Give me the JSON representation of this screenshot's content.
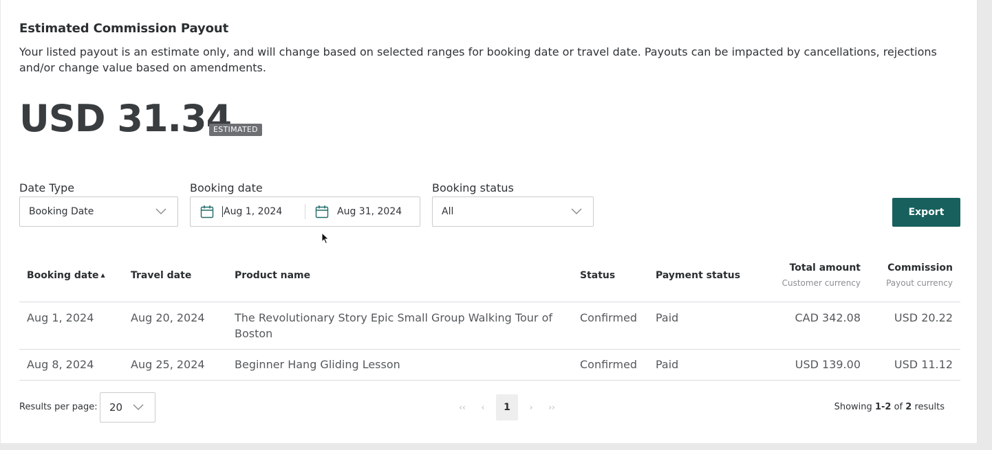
{
  "header": {
    "title": "Estimated Commission Payout",
    "description": "Your listed payout is an estimate only, and will change based on selected ranges for booking date or travel date. Payouts can be impacted by cancellations, rejections and/or change value based on amendments.",
    "amount": "USD 31.34",
    "badge": "ESTIMATED"
  },
  "filters": {
    "date_type_label": "Date Type",
    "date_type_value": "Booking Date",
    "booking_date_label": "Booking date",
    "start_date": "Aug 1, 2024",
    "end_date": "Aug 31, 2024",
    "status_label": "Booking status",
    "status_value": "All",
    "export_label": "Export"
  },
  "table": {
    "columns": {
      "booking_date": "Booking date",
      "travel_date": "Travel date",
      "product_name": "Product name",
      "status": "Status",
      "payment_status": "Payment status",
      "total_amount": "Total amount",
      "total_amount_sub": "Customer currency",
      "commission": "Commission",
      "commission_sub": "Payout currency"
    },
    "rows": [
      {
        "booking_date": "Aug 1, 2024",
        "travel_date": "Aug 20, 2024",
        "product_name": "The Revolutionary Story Epic Small Group Walking Tour of Boston",
        "status": "Confirmed",
        "payment_status": "Paid",
        "total_amount": "CAD 342.08",
        "commission": "USD 20.22"
      },
      {
        "booking_date": "Aug 8, 2024",
        "travel_date": "Aug 25, 2024",
        "product_name": "Beginner Hang Gliding Lesson",
        "status": "Confirmed",
        "payment_status": "Paid",
        "total_amount": "USD 139.00",
        "commission": "USD 11.12"
      }
    ]
  },
  "footer": {
    "per_page_label": "Results per page:",
    "per_page_value": "20",
    "current_page": "1",
    "showing_prefix": "Showing",
    "showing_range": "1-2",
    "showing_of": "of",
    "showing_total": "2",
    "showing_suffix": "results"
  },
  "colors": {
    "accent": "#17605d",
    "badge": "#6d6f72"
  }
}
